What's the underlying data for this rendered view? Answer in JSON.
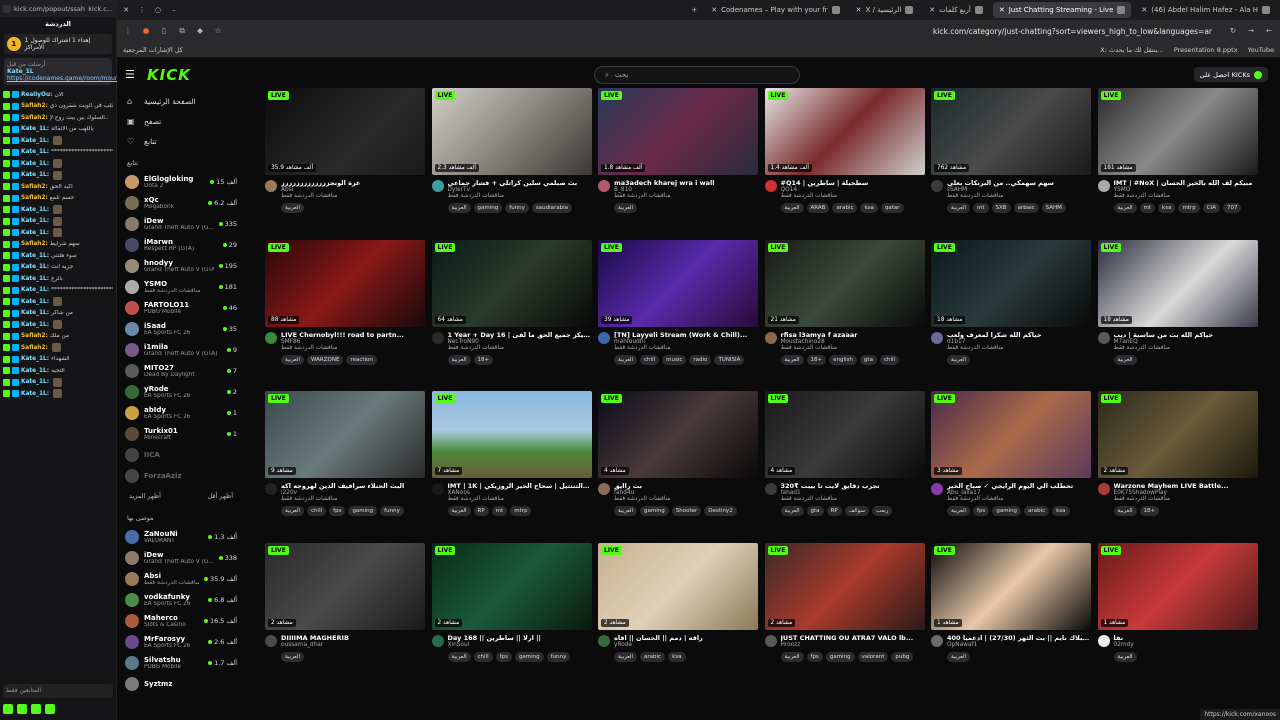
{
  "popout": {
    "url": "kick.com/popout/ssah...",
    "title_short": "kick.c...",
    "chat_title": "الدردشة",
    "goal_text": "إهداء 1 اشتراك للوصول 1 الأمراكز",
    "goal_badge": "1",
    "pin_label": "أرسلت من قبل",
    "pin_user": "Kate_1L",
    "pin_link": "https://codenames.game/room/moun...",
    "chat_rows": [
      {
        "user": "ReallyOu:",
        "text": "الان",
        "gold": false
      },
      {
        "user": "Saflah2:",
        "text": "كثلب في الويت شقرون ذي",
        "gold": true
      },
      {
        "user": "Saflah2:",
        "text": "السلوك بين بيت روح لإ..",
        "gold": true
      },
      {
        "user": "Kate_1L:",
        "text": "باللهب من الأثقالة",
        "gold": false
      },
      {
        "user": "Kate_1L:",
        "text": "",
        "gold": false
      },
      {
        "user": "Kate_1L:",
        "text": "**********************",
        "gold": false
      },
      {
        "user": "Kate_1L:",
        "text": "",
        "gold": false
      },
      {
        "user": "Kate_1L:",
        "text": "",
        "gold": false
      },
      {
        "user": "Saflah2:",
        "text": "اكيد الحق",
        "gold": true
      },
      {
        "user": "Saflah2:",
        "text": "حسم تلمع",
        "gold": true
      },
      {
        "user": "Kate_1L:",
        "text": "",
        "gold": false
      },
      {
        "user": "Kate_1L:",
        "text": "",
        "gold": false
      },
      {
        "user": "Kate_1L:",
        "text": "",
        "gold": false
      },
      {
        "user": "Saflah2:",
        "text": "سهم شرايط",
        "gold": true
      },
      {
        "user": "Kate_1L:",
        "text": "سوء هلنتي",
        "gold": false
      },
      {
        "user": "Kate_1L:",
        "text": "جزيه انت",
        "gold": false
      },
      {
        "user": "Kate_1L:",
        "text": "بالرغ",
        "gold": false
      },
      {
        "user": "Kate_1L:",
        "text": "**********************",
        "gold": false
      },
      {
        "user": "Kate_1L:",
        "text": "",
        "gold": false
      },
      {
        "user": "Kate_1L:",
        "text": "من شاكر",
        "gold": false
      },
      {
        "user": "Kate_1L:",
        "text": "",
        "gold": false
      },
      {
        "user": "Saflah2:",
        "text": "من ملك",
        "gold": true
      },
      {
        "user": "Saflah2:",
        "text": "",
        "gold": true
      },
      {
        "user": "Kate_1L:",
        "text": "الشهداء",
        "gold": false
      },
      {
        "user": "Kate_1L:",
        "text": "التحيه",
        "gold": false
      },
      {
        "user": "Kate_1L:",
        "text": "",
        "gold": false
      },
      {
        "user": "Kate_1L:",
        "text": "",
        "gold": false
      }
    ],
    "input_placeholder": "المتابعين فقط"
  },
  "tabs": [
    {
      "label": "Codenames – Play with your fr",
      "active": false
    },
    {
      "label": "X / الرئيسية",
      "active": false
    },
    {
      "label": "أربع كلمات",
      "active": false
    },
    {
      "label": "Just Chatting Streaming - Live",
      "active": true
    },
    {
      "label": "(46) Abdel Halim Hafez - Ala H",
      "active": false
    }
  ],
  "address": {
    "url": "kick.com/category/just-chatting?sort=viewers_high_to_low&languages=ar"
  },
  "bookmarks": {
    "left": "كل الإشارات المرجعية",
    "items": [
      "X: ينتقل لك ما يحدث...",
      "Presentation 8.pptx",
      "YouTube"
    ]
  },
  "kick": {
    "logo": "KICK",
    "search_placeholder": "بحث",
    "get_kick": "احصل على KICKs",
    "nav": [
      {
        "label": "الصفحة الرئيسية",
        "icon": "home-icon",
        "glyph": "⌂"
      },
      {
        "label": "تصفح",
        "icon": "browse-icon",
        "glyph": "▣"
      },
      {
        "label": "تتابع",
        "icon": "heart-icon",
        "glyph": "♡"
      }
    ],
    "following_title": "تتابع",
    "following": [
      {
        "name": "ElGlogloking",
        "cat": "Dota 2",
        "views": "15 ألف",
        "color": "#c89a6a"
      },
      {
        "name": "xQc",
        "cat": "Megabonk",
        "views": "6.2 ألف",
        "color": "#7a6a5a"
      },
      {
        "name": "iDew",
        "cat": "Grand Theft Auto V (G...",
        "views": "335",
        "color": "#8a7a6a"
      },
      {
        "name": "iMarwn",
        "cat": "Respect RP (GTA)",
        "views": "29",
        "color": "#4a4a6a"
      },
      {
        "name": "hnodyy",
        "cat": "Grand Theft Auto V (GTA)",
        "views": "195",
        "color": "#9a8a7a"
      },
      {
        "name": "YSMO",
        "cat": "مناقشات الدردشة فقط",
        "views": "181",
        "color": "#aaaaaa"
      },
      {
        "name": "FARTOLO11",
        "cat": "PUBG Mobile",
        "views": "46",
        "color": "#c05050"
      },
      {
        "name": "iSaad",
        "cat": "EA Sports FC 26",
        "views": "35",
        "color": "#6a8aaa"
      },
      {
        "name": "i1mila",
        "cat": "Grand Theft Auto V (GTA)",
        "views": "9",
        "color": "#7a5a8a"
      },
      {
        "name": "MITO27",
        "cat": "Dead By Daylight",
        "views": "7",
        "color": "#5a5a5a"
      },
      {
        "name": "yRode",
        "cat": "EA Sports FC 26",
        "views": "2",
        "color": "#3a6a3a"
      },
      {
        "name": "abIdy",
        "cat": "EA Sports FC 26",
        "views": "1",
        "color": "#c8a040"
      },
      {
        "name": "Turkix01",
        "cat": "Minecraft",
        "views": "1",
        "color": "#5a4a3a"
      },
      {
        "name": "IICA",
        "cat": "",
        "views": "",
        "color": "#444444",
        "off": true
      },
      {
        "name": "ForzaAziz",
        "cat": "",
        "views": "",
        "color": "#444444",
        "off": true
      }
    ],
    "more_left": "أظهر المزيد",
    "more_right": "أظهر أقل",
    "recommended_title": "موصى بها",
    "recommended": [
      {
        "name": "ZaNouNi",
        "cat": "VALORANT",
        "views": "1.3 ألف",
        "color": "#4a6aaa"
      },
      {
        "name": "iDew",
        "cat": "Grand Theft Auto V (G...",
        "views": "338",
        "color": "#8a7a6a"
      },
      {
        "name": "Absi",
        "cat": "مناقشات الدردشة فقط",
        "views": "35.9 ألف",
        "color": "#9a7a5a"
      },
      {
        "name": "vodkafunky",
        "cat": "EA Sports FC 26",
        "views": "6.8 ألف",
        "color": "#4a8a4a"
      },
      {
        "name": "Maherco",
        "cat": "Slots & Casino",
        "views": "16.5 ألف",
        "color": "#aa5a3a"
      },
      {
        "name": "MrFarosyy",
        "cat": "EA Sports FC 26",
        "views": "2.6 ألف",
        "color": "#6a4a8a"
      },
      {
        "name": "Silvatshu",
        "cat": "PUBG Mobile",
        "views": "1.7 ألف",
        "color": "#5a7a8a"
      },
      {
        "name": "Syztmz",
        "cat": "",
        "views": "",
        "color": "#7a7a7a"
      }
    ],
    "live_label": "LIVE",
    "streams": [
      {
        "title": "عزة الونجززززززززززززز",
        "channel": "Absi",
        "game": "مناقشات الدردشة فقط",
        "viewers": "35.9 ألف مشاهد",
        "tags": [
          "العربية"
        ],
        "bg": "linear-gradient(135deg,#0c0c0c,#2a2a2a 60%,#1a1a1a)",
        "avc": "#9a7a5a"
      },
      {
        "title": "بث صبلمي سلين كراتلي + فشار جماعي",
        "channel": "DylerTv",
        "game": "مناقشات الدردشة فقط",
        "viewers": "2.3 ألف مشاهد",
        "tags": [
          "العربية",
          "gaming",
          "funny",
          "saudiarabia"
        ],
        "bg": "linear-gradient(135deg,#d0cfc8,#8a8680 50%,#3a3836)",
        "avc": "#3aa0a0"
      },
      {
        "title": "ma3adech kharej wra i wall",
        "channel": "B_810",
        "game": "مناقشات الدردشة فقط",
        "viewers": "1.8 ألف مشاهد",
        "tags": [
          "العربية"
        ],
        "bg": "linear-gradient(135deg,#2a3a5a,#6a2a4a 50%,#2a2a3a)",
        "avc": "#b05a6a"
      },
      {
        "title": "#Q14 | سطحيلة | ساطرين",
        "channel": "QO14",
        "game": "مناقشات الدردشة فقط",
        "viewers": "1.4 ألف مشاهد",
        "tags": [
          "العربية",
          "ARAB",
          "arabic",
          "ksa",
          "qatar"
        ],
        "bg": "linear-gradient(135deg,#e6e6e6,#7a2a2a 50%,#cfcfcf)",
        "avc": "#d03030"
      },
      {
        "title": "سهم سهمكي.. من البرنكات بعلي",
        "channel": "sSAHM",
        "game": "مناقشات الدردشة فقط",
        "viewers": "762 مشاهد",
        "tags": [
          "العربية",
          "mt",
          "SXB",
          "arbaic",
          "SAHM"
        ],
        "bg": "linear-gradient(135deg,#1a2a2a,#4a4a4a 50%,#1a1a1a)",
        "avc": "#3a3a3a"
      },
      {
        "title": "IMT | #NoX | مبيكم لف الله بالخير الحسان",
        "channel": "YSMO",
        "game": "مناقشات الدردشة فقط",
        "viewers": "181 مشاهد",
        "tags": [
          "العربية",
          "mt",
          "ksa",
          "mtrp",
          "CIA",
          "707"
        ],
        "bg": "linear-gradient(135deg,#2a2a2a,#8a8a8a 50%,#1a1a1a)",
        "avc": "#aaaaaa"
      },
      {
        "title": "LIVE Chernobyl!!! road to partn...",
        "channel": "SMF86",
        "game": "مناقشات الدردشة فقط",
        "viewers": "88 مشاهد",
        "tags": [
          "العربية",
          "WARZONE",
          "reaction"
        ],
        "bg": "linear-gradient(135deg,#2a0808,#8a1818 50%,#1a0a0a)",
        "avc": "#3a8a3a"
      },
      {
        "title": "1 Year + Day 16 | كيكز جميع الحق ما لقى ...",
        "channel": "NecTroN90",
        "game": "مناقشات الدردشة فقط",
        "viewers": "64 مشاهد",
        "tags": [
          "العربية",
          "18+"
        ],
        "bg": "linear-gradient(135deg,#0a1a1a,#2a3a2a 50%,#0a0a0a)",
        "avc": "#2a2a2a"
      },
      {
        "title": "[TN] Layyeli Stream (Work & Chill)...",
        "channel": "mahfoudhi",
        "game": "مناقشات الدردشة فقط",
        "viewers": "39 مشاهد",
        "tags": [
          "العربية",
          "chill",
          "music",
          "radio",
          "TUNISIA"
        ],
        "bg": "linear-gradient(135deg,#1a0a4a,#5a2aaa 50%,#2a0a3a)",
        "avc": "#3a6aaa"
      },
      {
        "title": "rfisa l3amya f azaaar",
        "channel": "Moustachino28",
        "game": "مناقشات الدردشة فقط",
        "viewers": "21 مشاهد",
        "tags": [
          "العربية",
          "18+",
          "english",
          "gta",
          "chill"
        ],
        "bg": "linear-gradient(135deg,#1a1a1a,#3a4a3a 50%,#0a0a0a)",
        "avc": "#8a6a4a"
      },
      {
        "title": "حياكم الله شكرا لمعرف ولعب",
        "channel": "d1b17",
        "game": "مناقشات الدردشة فقط",
        "viewers": "18 مشاهد",
        "tags": [
          "العربية"
        ],
        "bg": "linear-gradient(135deg,#0a1a1a,#2a3a3a 50%,#0a0a0a)",
        "avc": "#6a6a9a"
      },
      {
        "title": "حياكم الله بث من ساسية | ديب",
        "channel": "M7anEQ",
        "game": "مناقشات الدردشة فقط",
        "viewers": "18 مشاهد",
        "tags": [
          "العربية"
        ],
        "bg": "linear-gradient(135deg,#2a2a3a,#dadada 55%,#3a3a4a)",
        "avc": "#5a5a5a"
      },
      {
        "title": "البث الحنلاء سرافيف الدين لهروجه اكه",
        "channel": "i220v",
        "game": "مناقشات الدردشة فقط",
        "viewers": "9 مشاهد",
        "tags": [
          "العربية",
          "chill",
          "fps",
          "gaming",
          "funny"
        ],
        "bg": "linear-gradient(135deg,#3a4a4a,#6a7a7a 50%,#2a2a2a)",
        "avc": "#222222"
      },
      {
        "title": "IMT | 1K | قانل التنتتيل | سحاح الحير الروزيكي ...",
        "channel": "XANoos",
        "game": "مناقشات الدردشة فقط",
        "viewers": "7 مشاهد",
        "tags": [
          "العربية",
          "RP",
          "mt",
          "mtrp"
        ],
        "bg": "linear-gradient(180deg,#8ab8e0,#a8c8e0 45%,#4a8a3a 70%,#6a5a3a)",
        "avc": "#1a1a1a"
      },
      {
        "title": "بث راايق",
        "channel": "fahd4u",
        "game": "مناقشات الدردشة فقط",
        "viewers": "4 مشاهد",
        "tags": [
          "العربية",
          "gaming",
          "Shooter",
          "Destiny2"
        ],
        "bg": "linear-gradient(135deg,#0a0a1a,#4a3a3a 50%,#0a0a0a)",
        "avc": "#8a6a5a"
      },
      {
        "title": "تجرب دقايق لايت تا بيبت ₹320",
        "channel": "fahad1",
        "game": "مناقشات الدردشة فقط",
        "viewers": "4 مشاهد",
        "tags": [
          "العربية",
          "gta",
          "RP",
          "سوالف",
          "ربعب"
        ],
        "bg": "linear-gradient(135deg,#1a1a1a,#3a3a3a 50%,#0a0a0a)",
        "avc": "#3a3a3a"
      },
      {
        "title": "تحطلب الي اليوم الرايجي ✓ صباح الخير",
        "channel": "Abu_laila17",
        "game": "مناقشات الدردشة فقط",
        "viewers": "3 مشاهد",
        "tags": [
          "العربية",
          "fps",
          "gaming",
          "arabic",
          "ksa"
        ],
        "bg": "linear-gradient(135deg,#4a2a4a,#aa6a4a 50%,#5a3a5a)",
        "avc": "#8a3aaa"
      },
      {
        "title": "Warzone Mayhem LIVE Battle...",
        "channel": "E0K75ShadowPlay",
        "game": "مناقشات الدردشة فقط",
        "viewers": "2 مشاهد",
        "tags": [
          "العربية",
          "18+"
        ],
        "bg": "linear-gradient(135deg,#2a2a1a,#6a5a3a 50%,#1a1a0a)",
        "avc": "#aa3a3a"
      },
      {
        "title": "DIIIIMA MAGHERIB",
        "channel": "oussama_dhar",
        "game": "",
        "viewers": "2 مشاهد",
        "tags": [
          "العربية"
        ],
        "bg": "linear-gradient(135deg,#2a2a2a,#4a4a4a 50%,#1a1a1a)",
        "avc": "#4a4a4a"
      },
      {
        "title": "Day 168 || ارلا || ساطرين ||",
        "channel": "XinSoul",
        "game": "",
        "viewers": "2 مشاهد",
        "tags": [
          "العربية",
          "chill",
          "fps",
          "gaming",
          "funny"
        ],
        "bg": "linear-gradient(135deg,#0a2a1a,#1a5a3a 50%,#0a1a0a)",
        "avc": "#2a6a4a"
      },
      {
        "title": "راقه | دمم || الحسان || اقاه",
        "channel": "yRode",
        "game": "",
        "viewers": "2 مشاهد",
        "tags": [
          "العربية",
          "arabic",
          "ksa"
        ],
        "bg": "linear-gradient(135deg,#c8b090,#e0d0b8 50%,#8a7a5a)",
        "avc": "#3a6a3a"
      },
      {
        "title": "JUST CHATTING OU ATRA7 VALO lb...",
        "channel": "Hroozz",
        "game": "",
        "viewers": "2 مشاهد",
        "tags": [
          "العربية",
          "fps",
          "gaming",
          "valorant",
          "pubg"
        ],
        "bg": "linear-gradient(135deg,#3a2a2a,#aa3a2a 50%,#2a1a1a)",
        "avc": "#5a5a5a"
      },
      {
        "title": "البلاك نايم || بث الثهر (27/30) | ادعميا 400₹",
        "channel": "OpNawaf1",
        "game": "",
        "viewers": "1 مشاهد",
        "tags": [
          "العربية"
        ],
        "bg": "linear-gradient(135deg,#0a0a0a,#e8c8a8 50%,#0a0a0a)",
        "avc": "#6a6a6a"
      },
      {
        "title": "نقا",
        "channel": "02mdy",
        "game": "",
        "viewers": "1 مشاهد",
        "tags": [
          "العربية"
        ],
        "bg": "linear-gradient(135deg,#6a1a1a,#c83a3a 50%,#4a1a1a)",
        "avc": "#eeeeee"
      }
    ]
  },
  "status_url": "https://kick.com/xanoos"
}
